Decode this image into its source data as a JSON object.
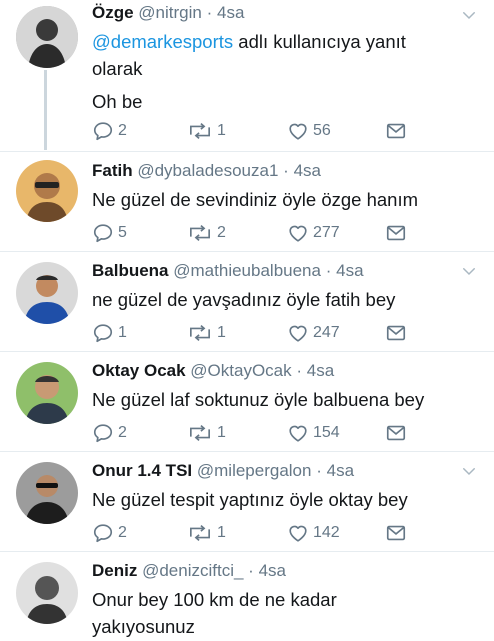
{
  "tweets": [
    {
      "name": "Özge",
      "handle": "@nitrgin",
      "dot": "·",
      "time": "4sa",
      "reply_to_mention": "@demarkesports",
      "reply_to_suffix": "adlı kullanıcıya yanıt olarak",
      "text": "Oh be",
      "replies": "2",
      "retweets": "1",
      "likes": "56"
    },
    {
      "name": "Fatih",
      "handle": "@dybaladesouza1",
      "dot": "·",
      "time": "4sa",
      "text": "Ne güzel de sevindiniz öyle özge hanım",
      "replies": "5",
      "retweets": "2",
      "likes": "277"
    },
    {
      "name": "Balbuena",
      "handle": "@mathieubalbuena",
      "dot": "·",
      "time": "4sa",
      "text": "ne güzel de yavşadınız öyle fatih bey",
      "replies": "1",
      "retweets": "1",
      "likes": "247"
    },
    {
      "name": "Oktay Ocak",
      "handle": "@OktayOcak",
      "dot": "·",
      "time": "4sa",
      "text": "Ne güzel laf soktunuz öyle balbuena bey",
      "replies": "2",
      "retweets": "1",
      "likes": "154"
    },
    {
      "name": "Onur 1.4 TSI",
      "handle": "@milepergalon",
      "dot": "·",
      "time": "4sa",
      "text": "Ne güzel tespit yaptınız öyle oktay bey",
      "replies": "2",
      "retweets": "1",
      "likes": "142"
    },
    {
      "name": "Deniz",
      "handle": "@denizciftci_",
      "dot": "·",
      "time": "4sa",
      "text": "Onur bey 100 km de ne kadar yakıyosunuz"
    }
  ],
  "icons": {
    "reply": "reply-icon",
    "retweet": "retweet-icon",
    "like": "heart-icon",
    "dm": "envelope-icon",
    "caret": "chevron-down-icon"
  },
  "colors": {
    "muted": "#657786",
    "mention": "#1b95e0",
    "text": "#14171a",
    "divider": "#e6ecf0"
  }
}
